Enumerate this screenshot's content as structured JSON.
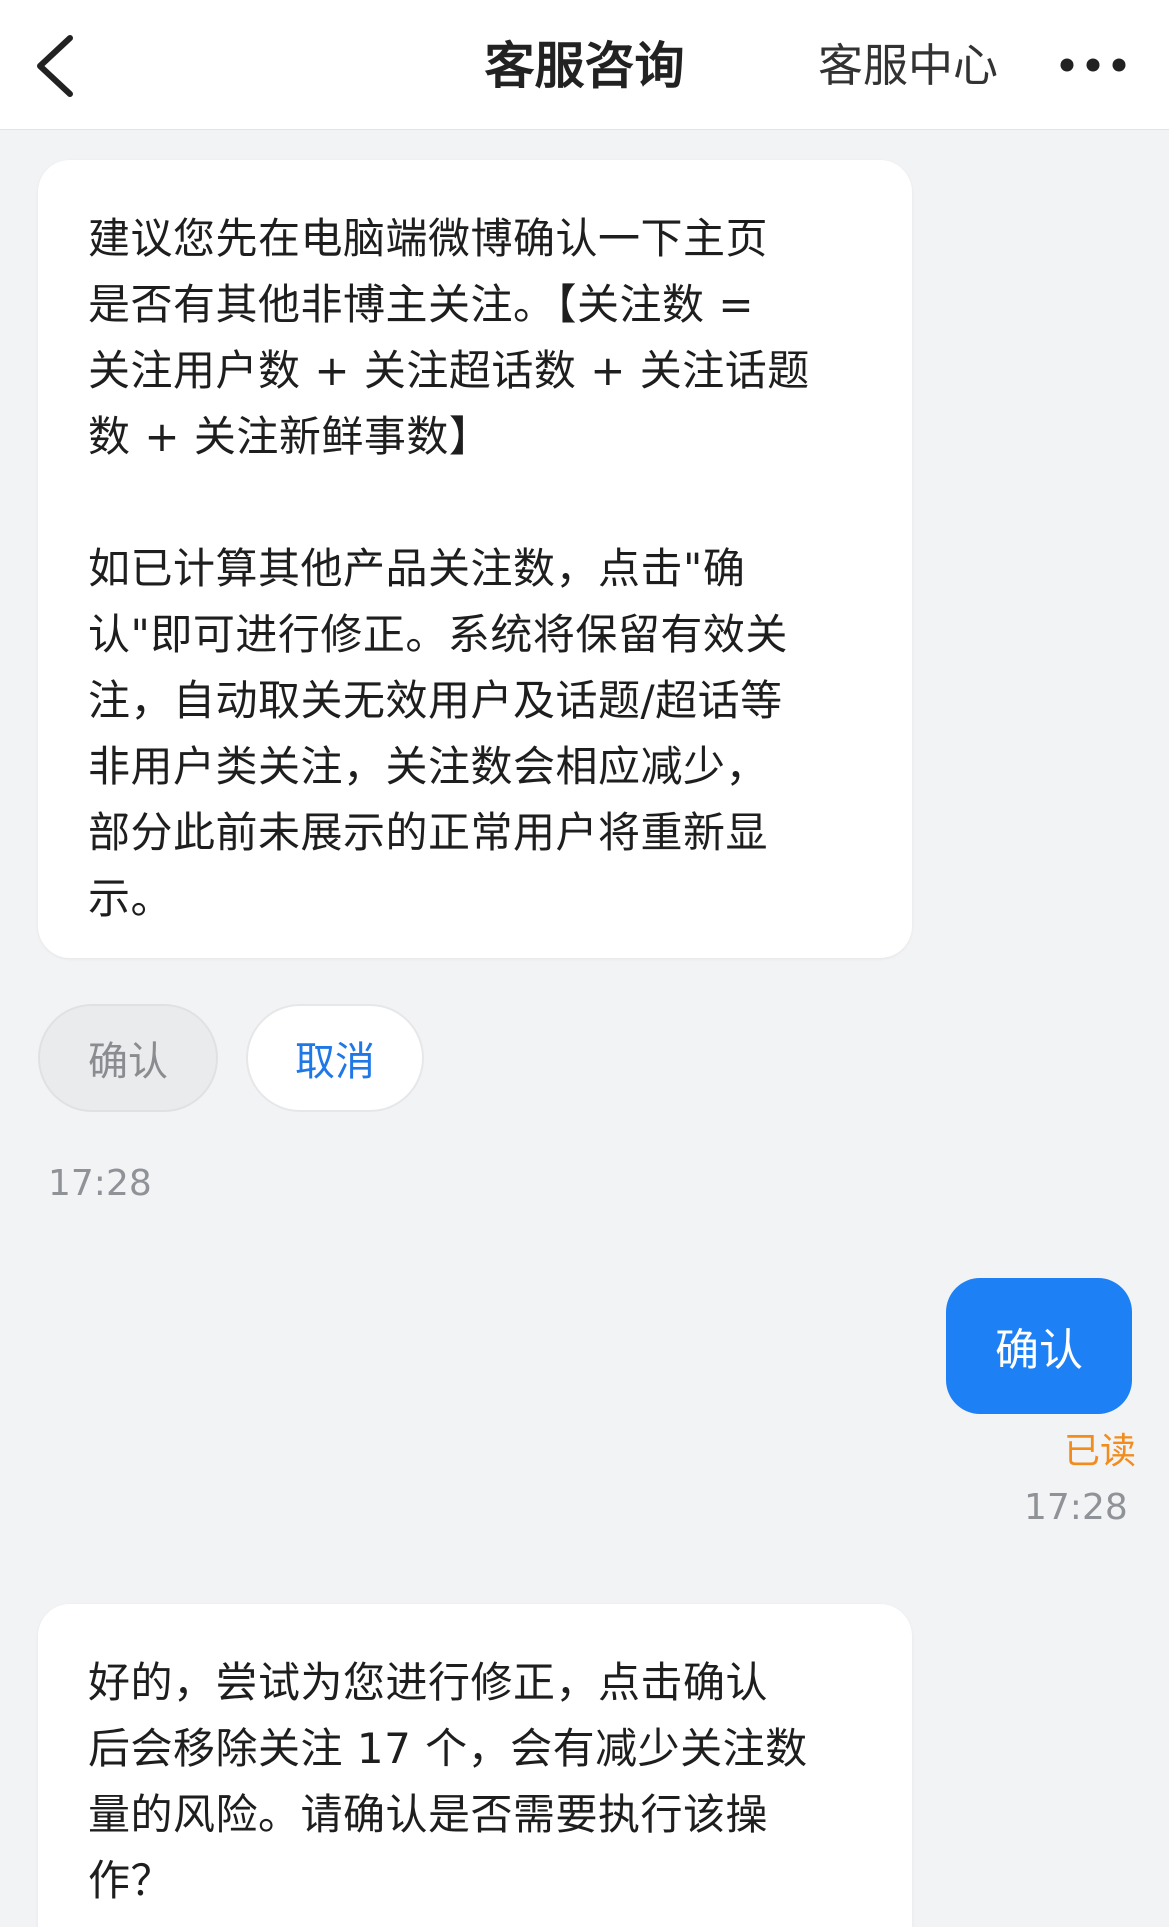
{
  "header": {
    "title": "客服咨询",
    "right_link": "客服中心"
  },
  "messages": {
    "agent_1": {
      "text": "建议您先在电脑端微博确认一下主页\n是否有其他非博主关注。【关注数 =\n关注用户数 + 关注超话数 + 关注话题\n数 + 关注新鲜事数】\n\n如已计算其他产品关注数，点击\"确\n认\"即可进行修正。系统将保留有效关\n注，自动取关无效用户及话题/超话等\n非用户类关注，关注数会相应减少，\n部分此前未展示的正常用户将重新显\n示。",
      "actions": {
        "confirm": "确认",
        "cancel": "取消"
      },
      "time": "17:28"
    },
    "user_1": {
      "text": "确认",
      "status": "已读",
      "time": "17:28"
    },
    "agent_2": {
      "text": "好的，尝试为您进行修正，点击确认\n后会移除关注 17 个，会有减少关注数\n量的风险。请确认是否需要执行该操\n作？"
    }
  },
  "colors": {
    "accent_blue": "#1e80f5",
    "read_orange": "#f28c1c",
    "background": "#f2f3f5"
  }
}
